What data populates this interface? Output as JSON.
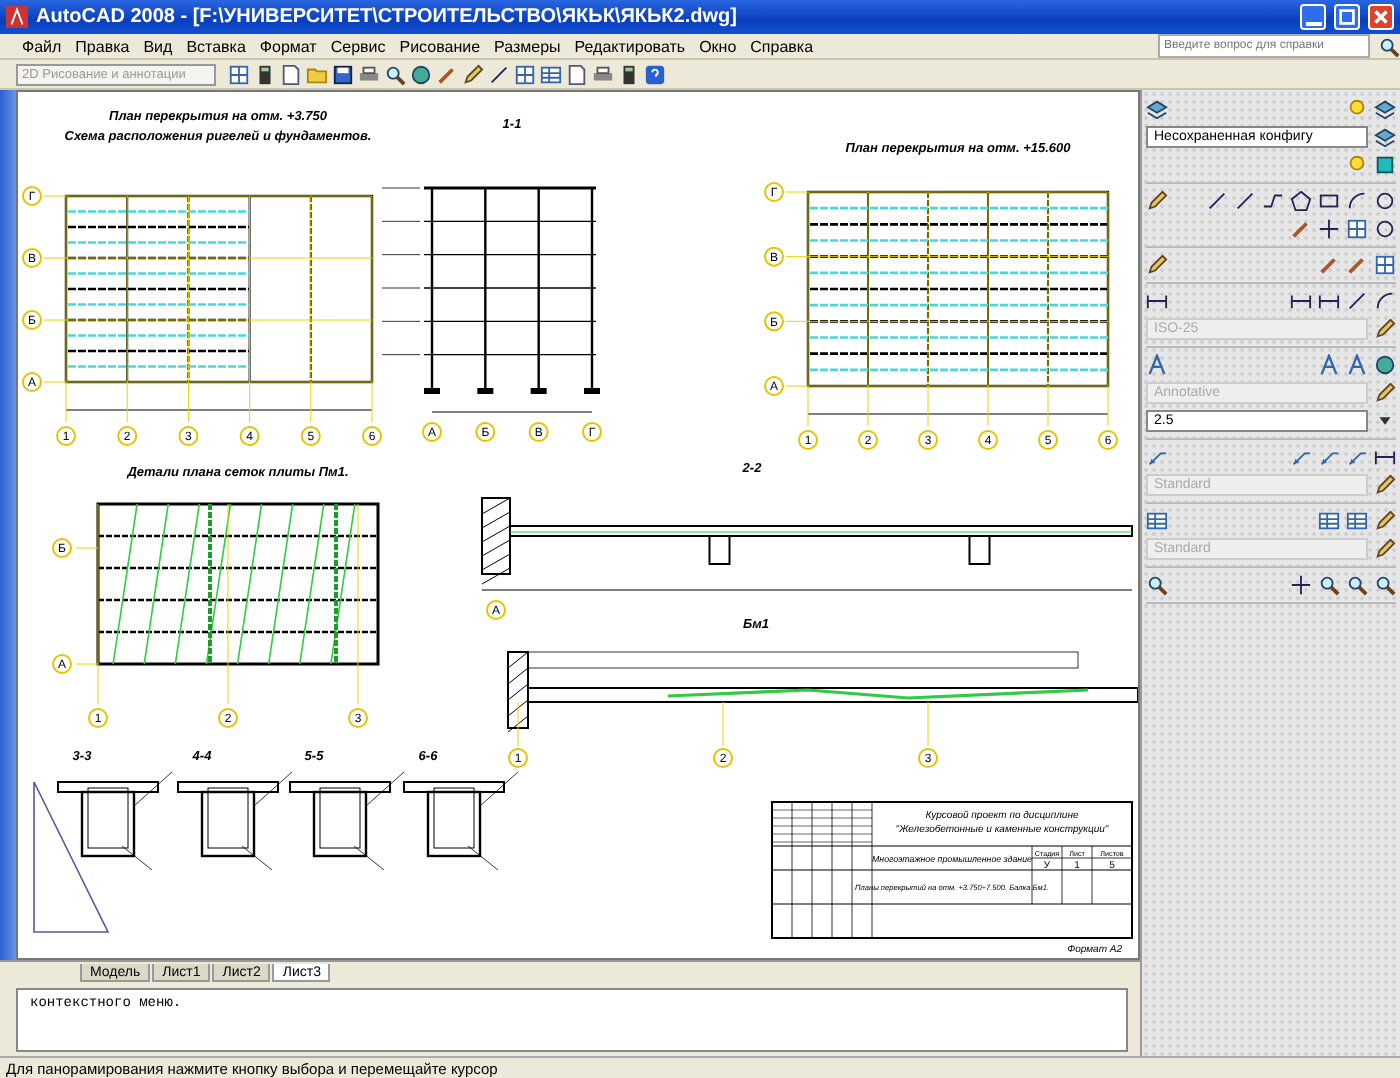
{
  "window": {
    "title": "AutoCAD 2008 - [F:\\УНИВЕРСИТЕТ\\СТРОИТЕЛЬСТВО\\ЯКЬК\\ЯКЬК2.dwg]"
  },
  "menu": [
    "Файл",
    "Правка",
    "Вид",
    "Вставка",
    "Формат",
    "Сервис",
    "Рисование",
    "Размеры",
    "Редактировать",
    "Окно",
    "Справка"
  ],
  "help_search": {
    "placeholder": "Введите вопрос для справки"
  },
  "toolbar": {
    "workspace": {
      "value": "2D Рисование и аннотации",
      "disabled": true
    }
  },
  "drawing": {
    "views": [
      {
        "kind": "plan",
        "titles": [
          "План перекрытия на отм. +3.750",
          "Схема расположения ригелей и фундаментов."
        ],
        "rows": [
          "Г",
          "В",
          "Б",
          "А"
        ],
        "cols": [
          "1",
          "2",
          "3",
          "4",
          "5",
          "6"
        ]
      },
      {
        "kind": "frame",
        "titles": [
          "1-1"
        ],
        "cols": [
          "А",
          "Б",
          "В",
          "Г"
        ]
      },
      {
        "kind": "plan",
        "titles": [
          "План перекрытия на отм. +15.600"
        ],
        "rows": [
          "Г",
          "В",
          "Б",
          "А"
        ],
        "cols": [
          "1",
          "2",
          "3",
          "4",
          "5",
          "6"
        ]
      },
      {
        "kind": "mesh",
        "titles": [
          "Детали плана сеток плиты Пм1."
        ],
        "rows": [
          "Б",
          "А"
        ],
        "cols": [
          "1",
          "2",
          "3"
        ]
      },
      {
        "kind": "slab",
        "titles": [
          "2-2"
        ],
        "cols": [
          "А"
        ]
      },
      {
        "kind": "cut",
        "titles": [
          "3-3"
        ]
      },
      {
        "kind": "cut",
        "titles": [
          "4-4"
        ]
      },
      {
        "kind": "cut",
        "titles": [
          "5-5"
        ]
      },
      {
        "kind": "cut",
        "titles": [
          "6-6"
        ]
      },
      {
        "kind": "beam",
        "titles": [
          "Бм1"
        ],
        "cols": [
          "1",
          "2",
          "3"
        ]
      }
    ],
    "title_block": {
      "course": [
        "Курсовой проект по дисциплине",
        "\"Железобетонные и каменные конструкции\""
      ],
      "building": "Многоэтажное промышленное здание",
      "sheet_title": "Планы перекрытий на отм. +3.750÷7.500. Балка Бм1.",
      "headers": [
        "Стадия",
        "Лист",
        "Листов"
      ],
      "values": [
        "У",
        "1",
        "5"
      ]
    },
    "format": "Формат А2"
  },
  "layout_tabs": [
    {
      "label": "Модель",
      "selected": false
    },
    {
      "label": "Лист1",
      "selected": false
    },
    {
      "label": "Лист2",
      "selected": false
    },
    {
      "label": "Лист3",
      "selected": true
    }
  ],
  "command": {
    "lines": [
      "контекстного меню."
    ]
  },
  "dashboard": {
    "combos": [
      {
        "value": "Несохраненная конфигу",
        "disabled": false
      },
      {
        "value": "ISO-25",
        "disabled": true
      },
      {
        "value": "Annotative",
        "disabled": true
      },
      {
        "value": "2.5",
        "disabled": false
      },
      {
        "value": "Standard",
        "disabled": true
      },
      {
        "value": "Standard",
        "disabled": true
      }
    ]
  },
  "status_bar": {
    "text": "Для панорамирования нажмите кнопку выбора и перемещайте курсор"
  }
}
